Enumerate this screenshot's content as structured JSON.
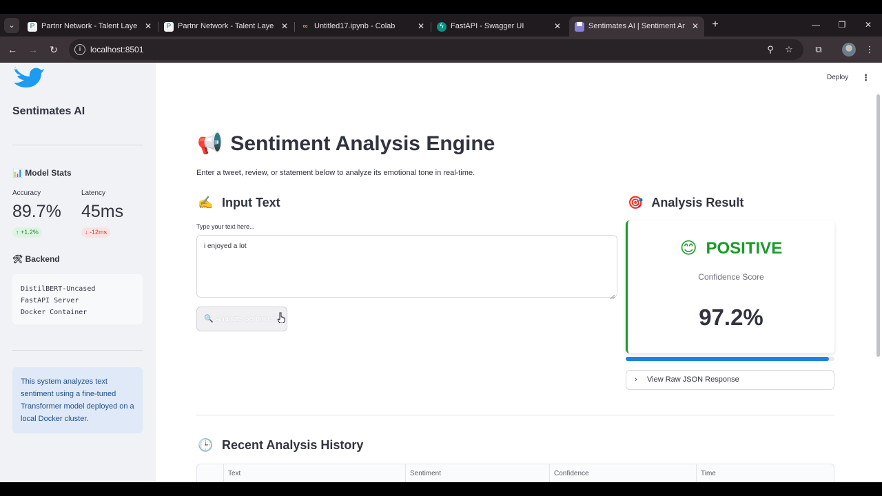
{
  "browser": {
    "tabs": [
      {
        "title": "Partnr Network - Talent Layer fo",
        "favicon": "partnr-icon",
        "active": false
      },
      {
        "title": "Partnr Network - Talent Layer fo",
        "favicon": "partnr-icon",
        "active": false
      },
      {
        "title": "Untitled17.ipynb - Colab",
        "favicon": "colab-icon",
        "active": false
      },
      {
        "title": "FastAPI - Swagger UI",
        "favicon": "fastapi-icon",
        "active": false
      },
      {
        "title": "Sentimates AI | Sentiment Analy",
        "favicon": "streamlit-icon",
        "active": true
      }
    ],
    "url": "localhost:8501",
    "new_tab": "+"
  },
  "app": {
    "deploy_label": "Deploy"
  },
  "sidebar": {
    "brand": "Sentimates AI",
    "model_stats_heading": "Model Stats",
    "model_stats_emoji": "📊",
    "metrics": [
      {
        "label": "Accuracy",
        "value": "89.7%",
        "delta": "+1.2%",
        "direction": "up"
      },
      {
        "label": "Latency",
        "value": "45ms",
        "delta": "-12ms",
        "direction": "down"
      }
    ],
    "backend_heading": "Backend",
    "backend_emoji": "🛠",
    "backend_lines": [
      "DistilBERT-Uncased",
      "FastAPI Server",
      "Docker Container"
    ],
    "info_text": "This system analyzes text sentiment using a fine-tuned Transformer model deployed on a local Docker cluster."
  },
  "main": {
    "title_emoji": "📢",
    "title": "Sentiment Analysis Engine",
    "subtitle": "Enter a tweet, review, or statement below to analyze its emotional tone in real-time.",
    "input_heading_emoji": "✍️",
    "input_heading": "Input Text",
    "textarea_label": "Type your text here...",
    "textarea_value": "i enjoyed a lot",
    "analyze_button_emoji": "🔍",
    "analyze_button": "Analyze Sentiment",
    "result_heading_emoji": "🎯",
    "result_heading": "Analysis Result",
    "result_emoji": "😊",
    "result_label": "POSITIVE",
    "confidence_label": "Confidence Score",
    "confidence_value": "97.2%",
    "confidence_fraction": 0.972,
    "json_expander": "View Raw JSON Response",
    "history_heading_emoji": "🕒",
    "history_heading": "Recent Analysis History",
    "history_columns": [
      "Text",
      "Sentiment",
      "Confidence",
      "Time"
    ]
  },
  "colors": {
    "positive": "#1a9b2a",
    "progress": "#1c83e1",
    "sidebar_bg": "#f0f2f6",
    "info_bg": "#dfe9f8"
  }
}
